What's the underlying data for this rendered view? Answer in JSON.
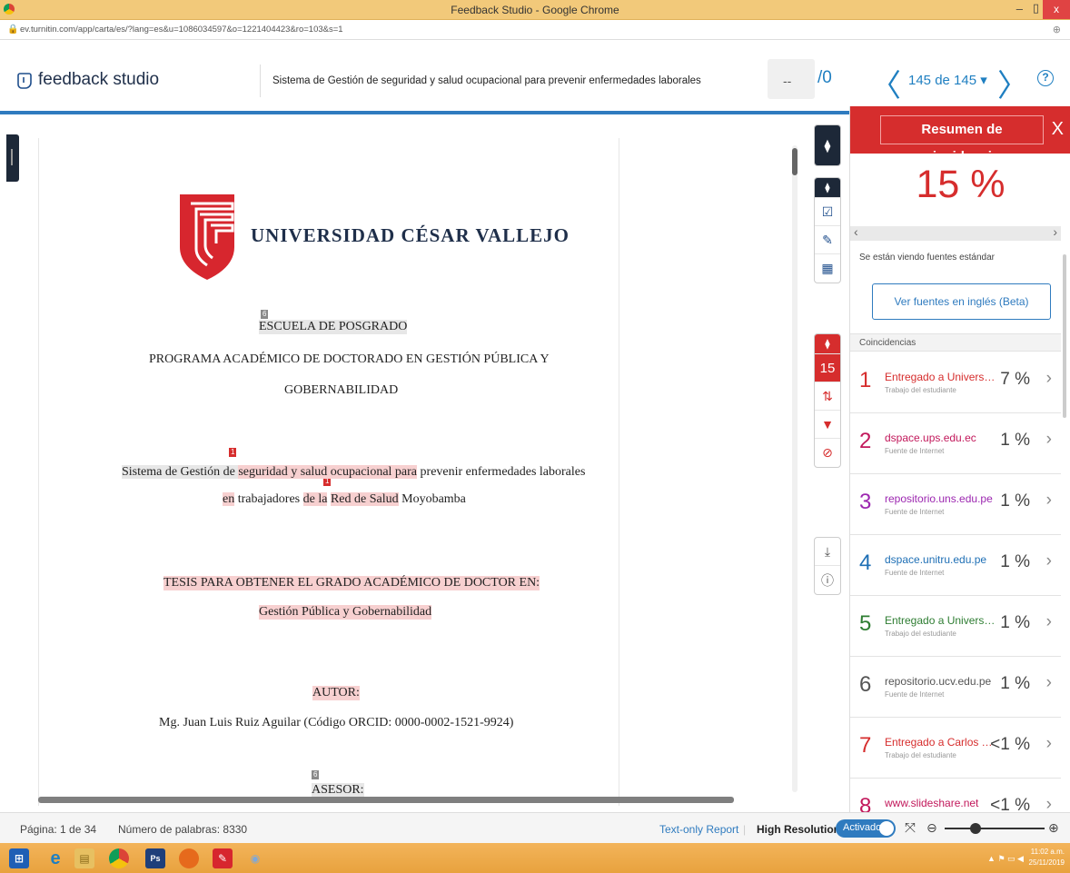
{
  "window": {
    "title": "Feedback Studio - Google Chrome",
    "min": "–",
    "max": "▯",
    "close": "x"
  },
  "urlbar": {
    "url": "ev.turnitin.com/app/carta/es/?lang=es&u=1086034597&o=1221404423&ro=103&s=1",
    "zoom_icon": "zoom-icon"
  },
  "header": {
    "logo": "feedback studio",
    "doc_title": "Sistema de Gestión de seguridad y salud ocupacional para prevenir enfermedades laborales",
    "score": "--",
    "score_max": "/0",
    "prev": "〈",
    "next": "〉",
    "counter": "145 de 145 ▾",
    "help": "?"
  },
  "document": {
    "logo_text": "UNIVERSIDAD CÉSAR VALLEJO",
    "school": "ESCUELA DE POSGRADO",
    "program_line1": "PROGRAMA ACADÉMICO DE DOCTORADO EN GESTIÓN PÚBLICA Y",
    "program_line2": "GOBERNABILIDAD",
    "title_a": "Sistema de Gestión de ",
    "title_b": "seguridad y salud ocupacional para",
    "title_c": " prevenir enfermedades laborales",
    "title2_a": "en",
    "title2_b": " trabajadores ",
    "title2_c": "de la",
    "title2_d": " ",
    "title2_e": "Red de Salud",
    "title2_f": " Moyobamba",
    "tesis": "TESIS PARA OBTENER EL GRADO ACADÉMICO DE DOCTOR EN:",
    "field": "Gestión Pública y Gobernabilidad",
    "autor_label": "AUTOR:",
    "autor": "Mg. Juan Luis Ruiz Aguilar (Código ORCID: 0000-0002-1521-9924)",
    "asesor_label": "ASESOR:",
    "marker_6": "6",
    "marker_1": "1"
  },
  "toolbar": {
    "similarity": "15"
  },
  "panel": {
    "title": "Resumen de coincidencias",
    "close": "X",
    "percent": "15 %",
    "std_note": "Se están viendo fuentes estándar",
    "english_button": "Ver fuentes en inglés (Beta)",
    "matches_label": "Coincidencias",
    "matches": [
      {
        "num": "1",
        "source": "Entregado a Universida...",
        "type": "Trabajo del estudiante",
        "pct": "7 %",
        "color": "#d62d2d"
      },
      {
        "num": "2",
        "source": "dspace.ups.edu.ec",
        "type": "Fuente de Internet",
        "pct": "1 %",
        "color": "#c2185b"
      },
      {
        "num": "3",
        "source": "repositorio.uns.edu.pe",
        "type": "Fuente de Internet",
        "pct": "1 %",
        "color": "#9c27b0"
      },
      {
        "num": "4",
        "source": "dspace.unitru.edu.pe",
        "type": "Fuente de Internet",
        "pct": "1 %",
        "color": "#1e6fb5"
      },
      {
        "num": "5",
        "source": "Entregado a Universida...",
        "type": "Trabajo del estudiante",
        "pct": "1 %",
        "color": "#2e7d32"
      },
      {
        "num": "6",
        "source": "repositorio.ucv.edu.pe",
        "type": "Fuente de Internet",
        "pct": "1 %",
        "color": "#555555"
      },
      {
        "num": "7",
        "source": "Entregado a Carlos Tes...",
        "type": "Trabajo del estudiante",
        "pct": "<1 %",
        "color": "#d62d2d"
      },
      {
        "num": "8",
        "source": "www.slideshare.net",
        "type": "Fuente de Internet",
        "pct": "<1 %",
        "color": "#c2185b"
      }
    ]
  },
  "status": {
    "page": "Página: 1 de 34",
    "words": "Número de palabras: 8330",
    "text_only": "Text-only Report",
    "high_res": "High Resolution",
    "toggle": "Activado"
  },
  "taskbar": {
    "time": "11:02 a.m.",
    "date": "25/11/2019"
  }
}
